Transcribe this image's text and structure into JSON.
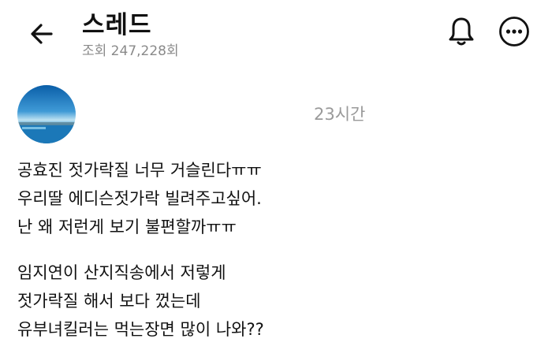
{
  "header": {
    "back_icon": "arrow-left-icon",
    "title": "스레드",
    "views": "조회 247,228회",
    "bell_icon": "bell-icon",
    "more_icon": "more-horizontal-icon"
  },
  "post": {
    "time": "23시간",
    "paragraphs": [
      [
        "공효진 젓가락질 너무 거슬린다ㅠㅠ",
        "우리딸 에디슨젓가락 빌려주고싶어.",
        "난 왜 저런게 보기 불편할까ㅠㅠ"
      ],
      [
        "임지연이 산지직송에서 저렇게",
        "젓가락질 해서 보다 껐는데",
        "유부녀킬러는 먹는장면 많이 나와??"
      ]
    ]
  }
}
